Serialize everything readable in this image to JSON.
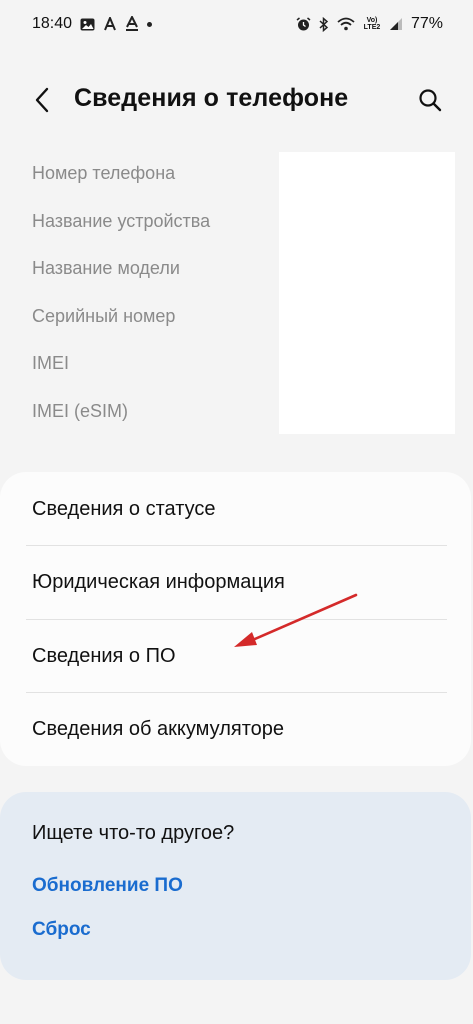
{
  "status_bar": {
    "time": "18:40",
    "left_icons": [
      "gallery-icon",
      "font-a-icon",
      "font-a-underline-icon",
      "notification-dot"
    ],
    "right_icons": [
      "alarm-icon",
      "bluetooth-icon",
      "wifi-icon",
      "volte-icon",
      "signal-icon"
    ],
    "volte_label": "Vo)\nLTE2",
    "battery": "77%"
  },
  "header": {
    "title": "Сведения о телефоне"
  },
  "info": {
    "rows": [
      "Номер телефона",
      "Название устройства",
      "Название модели",
      "Серийный номер",
      "IMEI",
      "IMEI (eSIM)"
    ]
  },
  "menu": {
    "items": [
      "Сведения о статусе",
      "Юридическая информация",
      "Сведения о ПО",
      "Сведения об аккумуляторе"
    ]
  },
  "suggestions": {
    "title": "Ищете что-то другое?",
    "links": [
      "Обновление ПО",
      "Сброс"
    ]
  },
  "colors": {
    "background": "#f4f4f4",
    "card": "#fcfcfc",
    "suggest_bg": "#e4ebf3",
    "link": "#1a6ccf",
    "muted_text": "#8a8a8a",
    "annotation_arrow": "#d42a2a"
  }
}
